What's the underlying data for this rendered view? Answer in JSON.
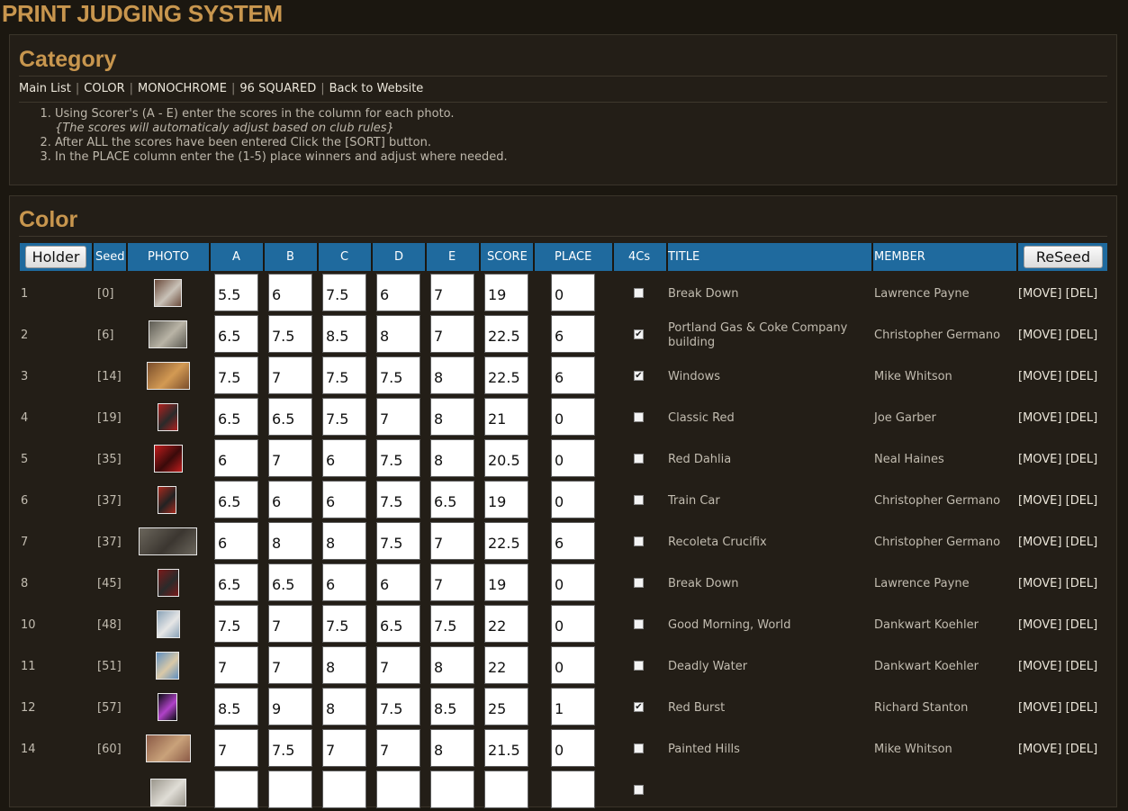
{
  "app_title": "PRINT JUDGING SYSTEM",
  "category_panel": {
    "heading": "Category",
    "nav": [
      "Main List",
      "COLOR",
      "MONOCHROME",
      "96 SQUARED",
      "Back to Website"
    ],
    "instructions": [
      "Using Scorer's (A - E) enter the scores in the column for each photo.",
      "{The scores will automaticaly adjust based on club rules}",
      "After ALL the scores have been entered Click the [SORT] button.",
      "In the PLACE column enter the (1-5) place winners and adjust where needed."
    ]
  },
  "color_panel": {
    "heading": "Color",
    "holder_button": "Holder",
    "reseed_button": "ReSeed",
    "columns": [
      "Seed",
      "PHOTO",
      "A",
      "B",
      "C",
      "D",
      "E",
      "SCORE",
      "PLACE",
      "4Cs",
      "TITLE",
      "MEMBER"
    ],
    "move_label": "[MOVE]",
    "del_label": "[DEL]",
    "rows": [
      {
        "num": "1",
        "seed": "[0]",
        "a": "5.5",
        "b": "6",
        "c": "7.5",
        "d": "6",
        "e": "7",
        "score": "19",
        "place": "0",
        "checked": false,
        "title": "Break Down",
        "member": "Lawrence Payne",
        "thumb": {
          "color": "#6a4a3a",
          "accent": "#c9c2b8"
        }
      },
      {
        "num": "2",
        "seed": "[6]",
        "a": "6.5",
        "b": "7.5",
        "c": "8.5",
        "d": "8",
        "e": "7",
        "score": "22.5",
        "place": "6",
        "checked": true,
        "title": "Portland Gas & Coke Company building",
        "member": "Christopher Germano",
        "thumb": {
          "color": "#5c5a52",
          "accent": "#b9b4a6"
        }
      },
      {
        "num": "3",
        "seed": "[14]",
        "a": "7.5",
        "b": "7",
        "c": "7.5",
        "d": "7.5",
        "e": "8",
        "score": "22.5",
        "place": "6",
        "checked": true,
        "title": "Windows",
        "member": "Mike Whitson",
        "thumb": {
          "color": "#7a4e2c",
          "accent": "#d39a53"
        }
      },
      {
        "num": "4",
        "seed": "[19]",
        "a": "6.5",
        "b": "6.5",
        "c": "7.5",
        "d": "7",
        "e": "8",
        "score": "21",
        "place": "0",
        "checked": false,
        "title": "Classic Red",
        "member": "Joe Garber",
        "thumb": {
          "color": "#b0201e",
          "accent": "#2a2a2a"
        }
      },
      {
        "num": "5",
        "seed": "[35]",
        "a": "6",
        "b": "7",
        "c": "6",
        "d": "7.5",
        "e": "8",
        "score": "20.5",
        "place": "0",
        "checked": false,
        "title": "Red Dahlia",
        "member": "Neal Haines",
        "thumb": {
          "color": "#c01c1c",
          "accent": "#3a0a0a"
        }
      },
      {
        "num": "6",
        "seed": "[37]",
        "a": "6.5",
        "b": "6",
        "c": "6",
        "d": "7.5",
        "e": "6.5",
        "score": "19",
        "place": "0",
        "checked": false,
        "title": "Train Car",
        "member": "Christopher Germano",
        "thumb": {
          "color": "#a82a1e",
          "accent": "#222222"
        }
      },
      {
        "num": "7",
        "seed": "[37]",
        "a": "6",
        "b": "8",
        "c": "8",
        "d": "7.5",
        "e": "7",
        "score": "22.5",
        "place": "6",
        "checked": false,
        "title": "Recoleta Crucifix",
        "member": "Christopher Germano",
        "thumb": {
          "color": "#6b665c",
          "accent": "#3b3630"
        }
      },
      {
        "num": "8",
        "seed": "[45]",
        "a": "6.5",
        "b": "6.5",
        "c": "6",
        "d": "6",
        "e": "7",
        "score": "19",
        "place": "0",
        "checked": false,
        "title": "Break Down",
        "member": "Lawrence Payne",
        "thumb": {
          "color": "#7a1a1a",
          "accent": "#2a2a2a"
        }
      },
      {
        "num": "10",
        "seed": "[48]",
        "a": "7.5",
        "b": "7",
        "c": "7.5",
        "d": "6.5",
        "e": "7.5",
        "score": "22",
        "place": "0",
        "checked": false,
        "title": "Good Morning, World",
        "member": "Dankwart Koehler",
        "thumb": {
          "color": "#8aa3b8",
          "accent": "#e6e6e6"
        }
      },
      {
        "num": "11",
        "seed": "[51]",
        "a": "7",
        "b": "7",
        "c": "8",
        "d": "7",
        "e": "8",
        "score": "22",
        "place": "0",
        "checked": false,
        "title": "Deadly Water",
        "member": "Dankwart Koehler",
        "thumb": {
          "color": "#5f8fc0",
          "accent": "#d9c9a8"
        }
      },
      {
        "num": "12",
        "seed": "[57]",
        "a": "8.5",
        "b": "9",
        "c": "8",
        "d": "7.5",
        "e": "8.5",
        "score": "25",
        "place": "1",
        "checked": true,
        "title": "Red Burst",
        "member": "Richard Stanton",
        "thumb": {
          "color": "#0a0a12",
          "accent": "#b042c8"
        }
      },
      {
        "num": "14",
        "seed": "[60]",
        "a": "7",
        "b": "7.5",
        "c": "7",
        "d": "7",
        "e": "8",
        "score": "21.5",
        "place": "0",
        "checked": false,
        "title": "Painted Hills",
        "member": "Mike Whitson",
        "thumb": {
          "color": "#8b5a46",
          "accent": "#c9a27a"
        }
      },
      {
        "num": "",
        "seed": "",
        "a": "",
        "b": "",
        "c": "",
        "d": "",
        "e": "",
        "score": "",
        "place": "",
        "checked": false,
        "title": "",
        "member": "",
        "thumb": {
          "color": "#9a968c",
          "accent": "#e0ddd6"
        }
      }
    ]
  }
}
